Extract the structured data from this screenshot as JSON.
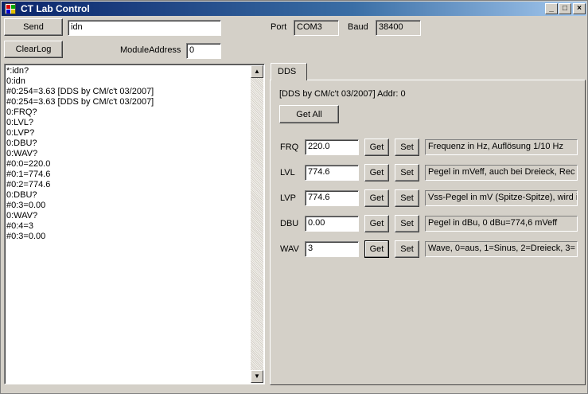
{
  "window": {
    "title": "CT Lab Control",
    "controls": {
      "minimize": "_",
      "maximize": "□",
      "close": "×"
    }
  },
  "toolbar": {
    "send_label": "Send",
    "command_value": "idn",
    "clearlog_label": "ClearLog",
    "module_address_label": "ModuleAddress",
    "module_address_value": "0",
    "port_label": "Port",
    "port_value": "COM3",
    "baud_label": "Baud",
    "baud_value": "38400"
  },
  "log": {
    "lines": [
      "*:idn?",
      "0:idn",
      "#0:254=3.63 [DDS by CM/c't 03/2007]",
      "#0:254=3.63 [DDS by CM/c't 03/2007]",
      "0:FRQ?",
      "0:LVL?",
      "0:LVP?",
      "0:DBU?",
      "0:WAV?",
      "#0:0=220.0",
      "#0:1=774.6",
      "#0:2=774.6",
      "0:DBU?",
      "#0:3=0.00",
      "0:WAV?",
      "#0:4=3",
      "#0:3=0.00"
    ]
  },
  "dds": {
    "tab_label": "DDS",
    "info": "[DDS by CM/c't 03/2007] Addr: 0",
    "get_all_label": "Get All",
    "get_label": "Get",
    "set_label": "Set",
    "params": [
      {
        "name": "FRQ",
        "value": "220.0",
        "desc": "Frequenz in Hz, Auflösung 1/10 Hz"
      },
      {
        "name": "LVL",
        "value": "774.6",
        "desc": "Pegel in mVeff, auch bei Dreieck, Rec"
      },
      {
        "name": "LVP",
        "value": "774.6",
        "desc": "Vss-Pegel in mV (Spitze-Spitze), wird int"
      },
      {
        "name": "DBU",
        "value": "0.00",
        "desc": "Pegel in dBu, 0 dBu=774,6 mVeff"
      },
      {
        "name": "WAV",
        "value": "3",
        "desc": "Wave, 0=aus, 1=Sinus, 2=Dreieck, 3="
      }
    ]
  }
}
